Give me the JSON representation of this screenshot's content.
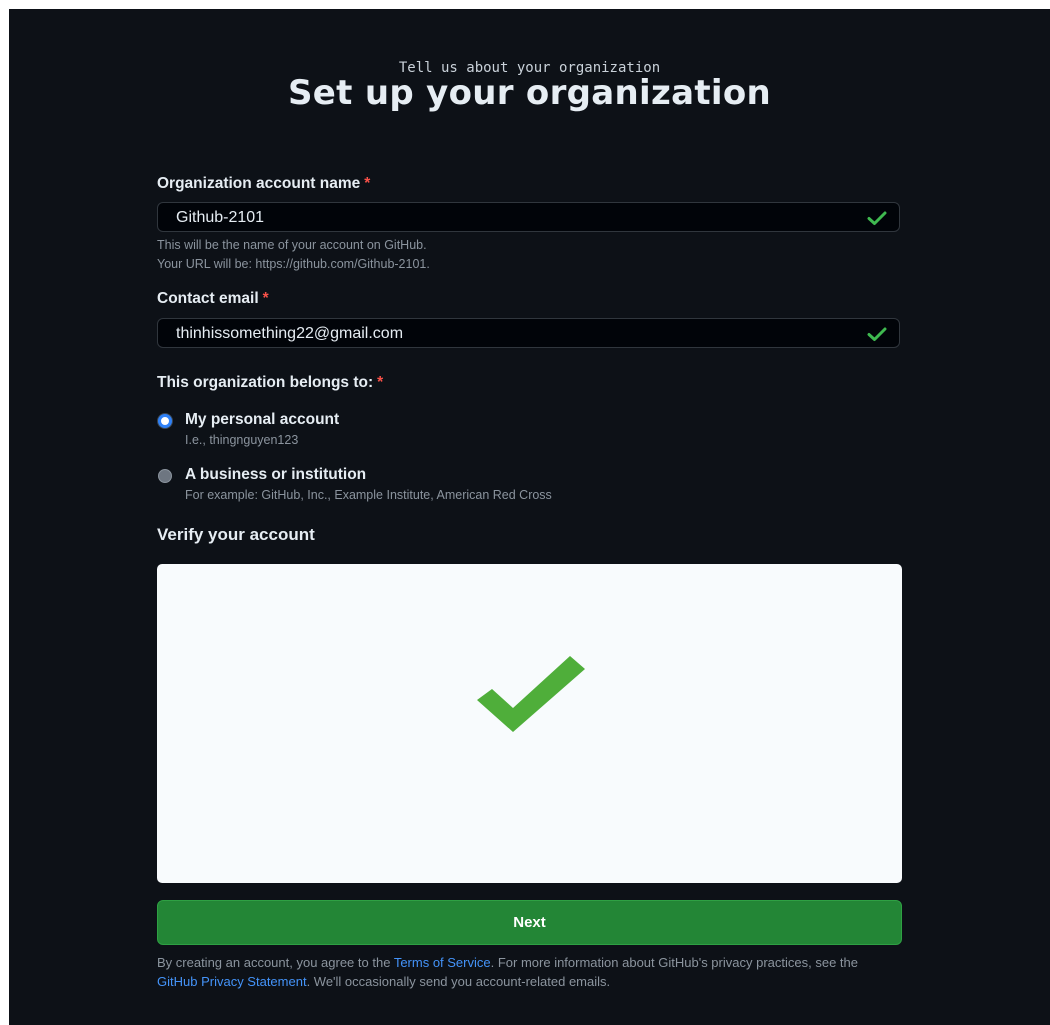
{
  "header": {
    "subtitle": "Tell us about your organization",
    "title": "Set up your organization"
  },
  "org_name": {
    "label": "Organization account name",
    "required_mark": "*",
    "value": "Github-2101",
    "valid_icon": "check-icon",
    "hint_line1": "This will be the name of your account on GitHub.",
    "hint_line2": "Your URL will be: https://github.com/Github-2101."
  },
  "contact_email": {
    "label": "Contact email",
    "required_mark": "*",
    "value": "thinhissomething22@gmail.com",
    "valid_icon": "check-icon"
  },
  "belongs_to": {
    "label": "This organization belongs to:",
    "required_mark": "*",
    "options": [
      {
        "label": "My personal account",
        "hint": "I.e., thingnguyen123",
        "checked": true
      },
      {
        "label": "A business or institution",
        "hint": "For example: GitHub, Inc., Example Institute, American Red Cross",
        "checked": false
      }
    ]
  },
  "verify": {
    "label": "Verify your account",
    "status_icon": "large-check-icon"
  },
  "next_button": {
    "label": "Next"
  },
  "legal": {
    "part1": "By creating an account, you agree to the ",
    "terms_link": "Terms of Service",
    "part2": ". For more information about GitHub's privacy practices, see the ",
    "privacy_link": "GitHub Privacy Statement",
    "part3": ". We'll occasionally send you account-related emails."
  },
  "colors": {
    "background": "#0d1117",
    "input_background": "#010409",
    "accent_green": "#238636",
    "check_green": "#3fb950",
    "required_red": "#f85149",
    "link_blue": "#4493f8",
    "muted_text": "#8b949e"
  }
}
